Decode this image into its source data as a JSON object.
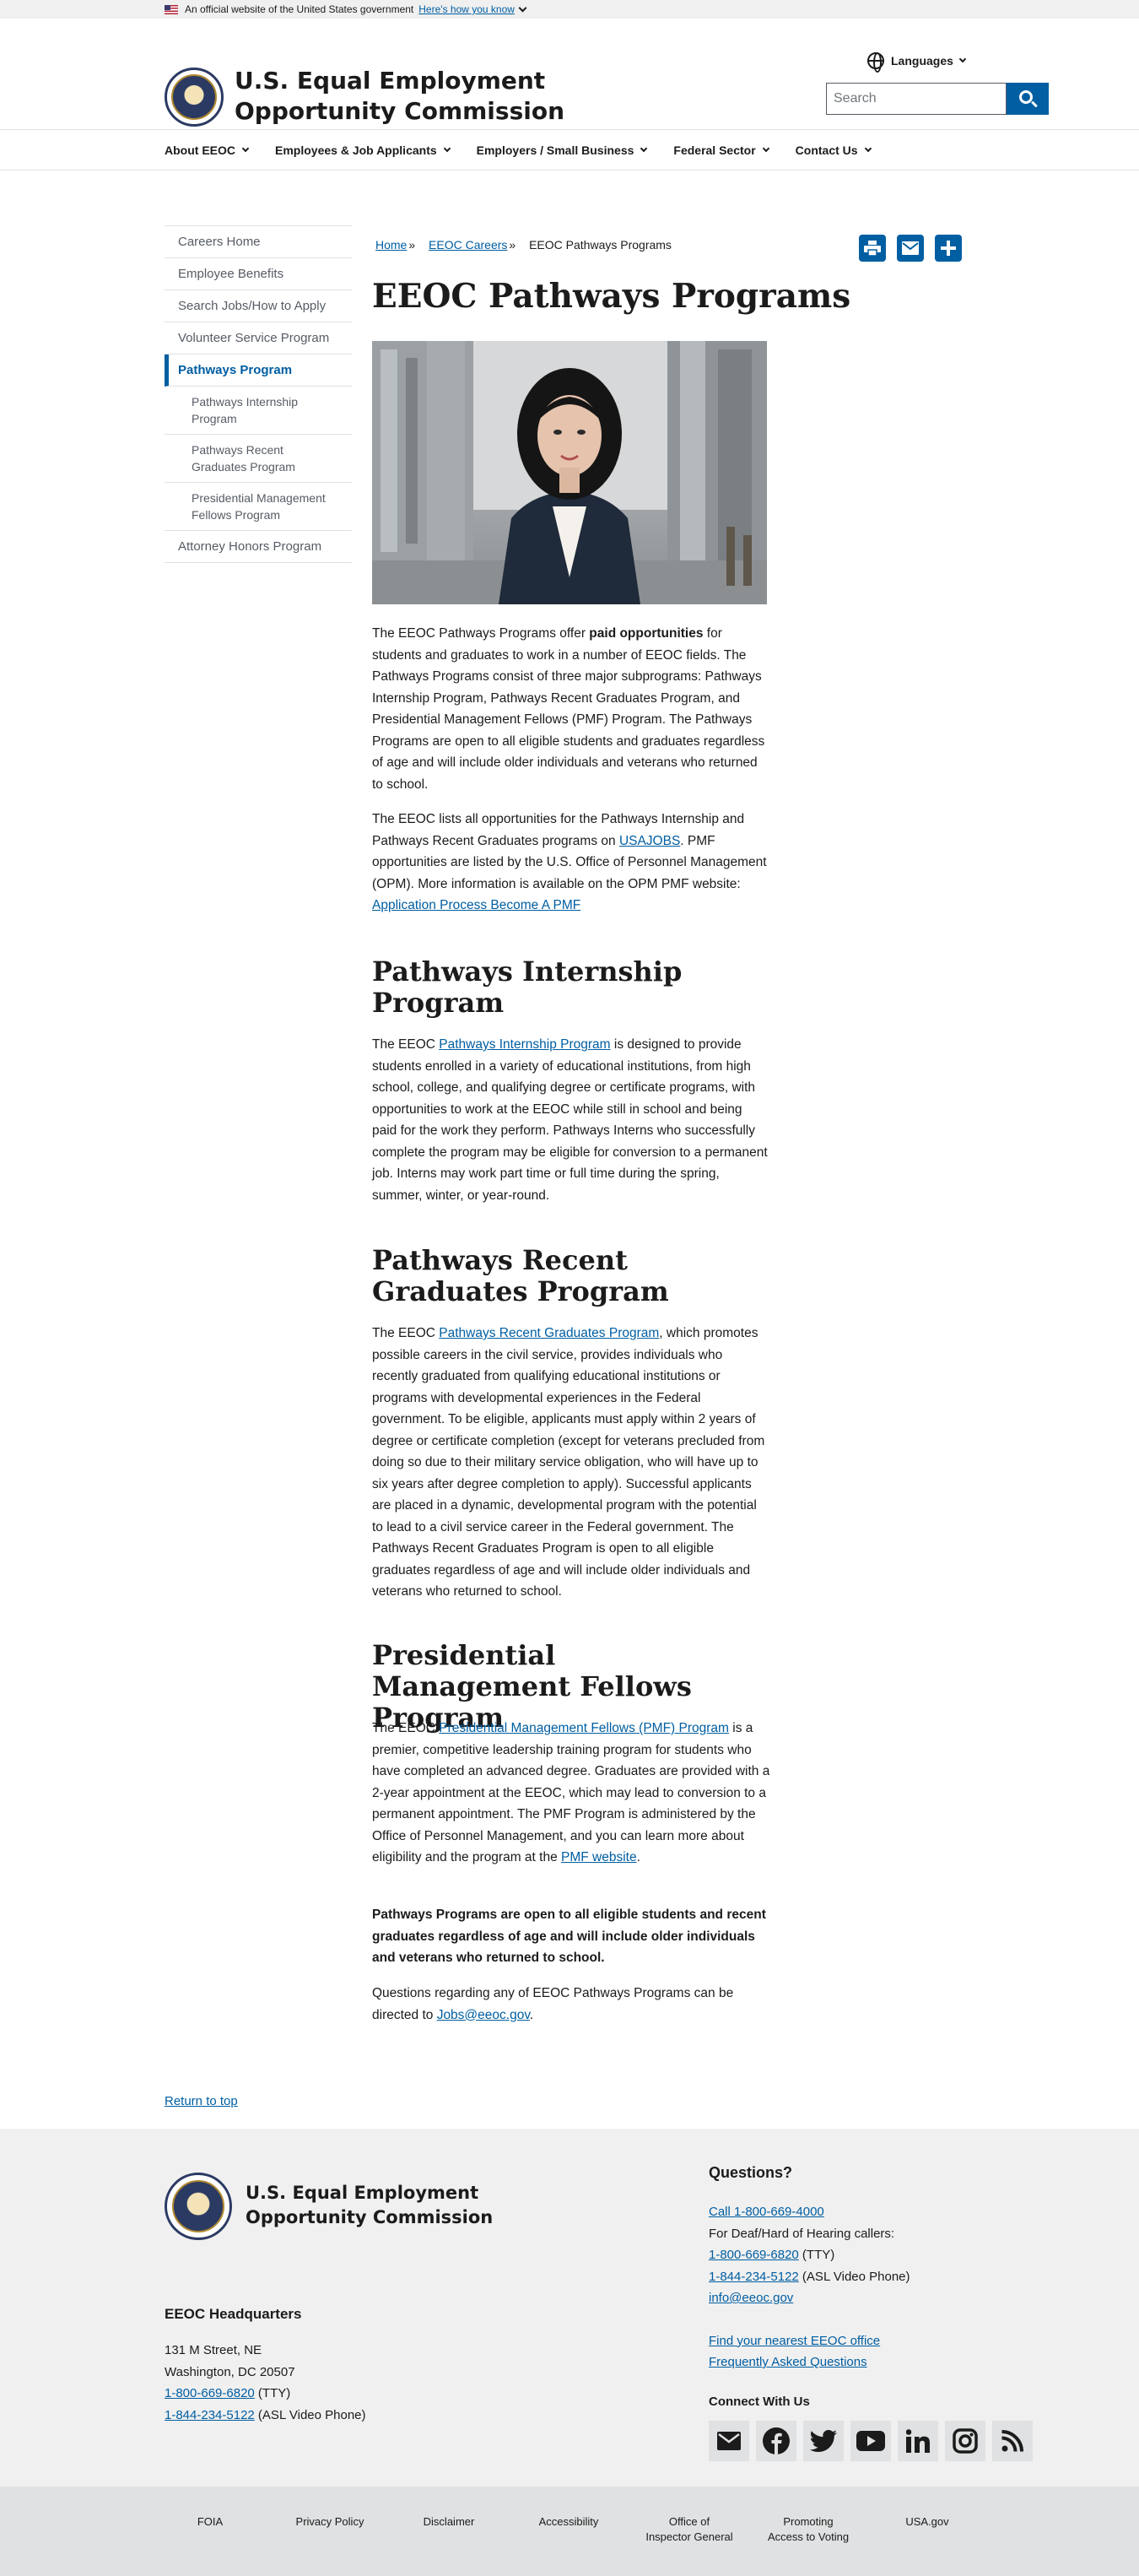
{
  "gov_banner": {
    "text": "An official website of the United States government",
    "link": "Here's how you know"
  },
  "header": {
    "title_line1": "U.S. Equal Employment",
    "title_line2": "Opportunity Commission",
    "languages": "Languages",
    "search_placeholder": "Search"
  },
  "nav": {
    "items": [
      {
        "label": "About EEOC"
      },
      {
        "label": "Employees & Job Applicants"
      },
      {
        "label": "Employers / Small Business"
      },
      {
        "label": "Federal Sector"
      },
      {
        "label": "Contact Us"
      }
    ]
  },
  "sidebar": {
    "items": [
      {
        "label": "Careers Home"
      },
      {
        "label": "Employee Benefits"
      },
      {
        "label": "Search Jobs/How to Apply"
      },
      {
        "label": "Volunteer Service Program"
      },
      {
        "label": "Pathways Program"
      },
      {
        "label": "Pathways Internship Program"
      },
      {
        "label": "Pathways Recent Graduates Program"
      },
      {
        "label": "Presidential Management Fellows Program"
      },
      {
        "label": "Attorney Honors Program"
      }
    ]
  },
  "breadcrumb": {
    "home": "Home",
    "careers": "EEOC Careers",
    "current": "EEOC Pathways Programs",
    "sep": "»"
  },
  "page": {
    "title": "EEOC Pathways Programs",
    "intro_1a": "The EEOC Pathways Programs offer ",
    "intro_1b": "paid opportunities",
    "intro_1c": " for students and graduates to work in a number of EEOC fields.  The Pathways Programs consist of three major subprograms: Pathways Internship Program, Pathways Recent Graduates Program, and Presidential Management Fellows (PMF) Program.  The Pathways Programs are open to all eligible students and graduates regardless of age and will include older individuals and veterans who returned to school.",
    "intro_2a": "The EEOC lists all opportunities for the Pathways Internship and Pathways Recent Graduates programs on ",
    "intro_2_link": "USAJOBS",
    "intro_2b": ". PMF opportunities are listed by the U.S. Office of Personnel Management (OPM). More information is available on the OPM PMF website: ",
    "intro_2_link2": "Application Process Become A PMF",
    "h2_intern": "Pathways Internship Program",
    "intern_a": "The EEOC ",
    "intern_link": "Pathways Internship Program",
    "intern_b": " is designed to provide students enrolled in a variety of educational institutions, from high school, college, and qualifying degree or certificate programs, with opportunities to work at the EEOC while still in school and being paid for the work they perform. Pathways Interns who successfully complete the program may be eligible for conversion to a permanent job. Interns may work part time or full time during the spring, summer, winter, or year-round.",
    "h2_grads": "Pathways Recent Graduates Program",
    "grads_a": "The EEOC ",
    "grads_link": "Pathways Recent Graduates Program",
    "grads_b": ", which promotes possible careers in the civil service, provides individuals who recently graduated from qualifying educational institutions or programs with developmental experiences in the Federal government. To be eligible, applicants must apply within 2 years of degree or certificate completion (except for veterans precluded from doing so due to their military service obligation, who will have up to six years after degree completion to apply). Successful applicants are placed in a dynamic, developmental program with the potential to lead to a civil service career in the Federal government. The Pathways Recent Graduates Program is open to all eligible graduates regardless of age and will include older individuals and veterans who returned to school.",
    "h2_pmf": "Presidential Management Fellows Program",
    "pmf_a": "The EEOC ",
    "pmf_link": "Presidential Management Fellows (PMF) Program",
    "pmf_b": " is a premier, competitive leadership training program for students who have completed an advanced degree. Graduates are provided with a 2-year appointment at the EEOC, which may lead to conversion to a permanent appointment. The PMF Program is administered by the Office of Personnel Management, and you can learn more about eligibility and the program at the ",
    "pmf_link2": "PMF website",
    "pmf_c": ".",
    "bold_note": "Pathways Programs are open to all eligible students and recent graduates regardless of age and will include older individuals and veterans who returned to school.",
    "questions_a": "Questions regarding any of EEOC Pathways Programs can be directed to ",
    "questions_link": "Jobs@eeoc.gov",
    "questions_b": "."
  },
  "return_top": "Return to top",
  "footer": {
    "title_line1": "U.S. Equal Employment",
    "title_line2": "Opportunity Commission",
    "hq_title": "EEOC Headquarters",
    "hq_addr1": "131 M Street, NE",
    "hq_addr2": "Washington, DC 20507",
    "hq_tty": "1-800-669-6820",
    "hq_tty_suffix": " (TTY)",
    "hq_asl": "1-844-234-5122",
    "hq_asl_suffix": " (ASL Video Phone)",
    "q_title": "Questions?",
    "q_call": "Call 1-800-669-4000",
    "q_deaf": "For Deaf/Hard of Hearing callers:",
    "q_tty": "1-800-669-6820",
    "q_tty_suffix": " (TTY)",
    "q_asl": "1-844-234-5122",
    "q_asl_suffix": " (ASL Video Phone)",
    "q_email": "info@eeoc.gov",
    "q_office": "Find your nearest EEOC office",
    "q_faq": "Frequently Asked Questions",
    "connect": "Connect With Us",
    "socials": [
      "email-icon",
      "facebook-icon",
      "twitter-icon",
      "youtube-icon",
      "linkedin-icon",
      "instagram-icon",
      "rss-icon"
    ]
  },
  "bottom_links": {
    "foia": "FOIA",
    "privacy": "Privacy Policy",
    "disclaimer": "Disclaimer",
    "accessibility": "Accessibility",
    "oig_line1": "Office of",
    "oig_line2": "Inspector General",
    "voting_line1": "Promoting",
    "voting_line2": "Access to Voting",
    "usagov": "USA.gov"
  },
  "colors": {
    "link": "#005ea2",
    "footer_bg": "#f0f0f0",
    "bottom_bar": "#dfe1e2"
  }
}
